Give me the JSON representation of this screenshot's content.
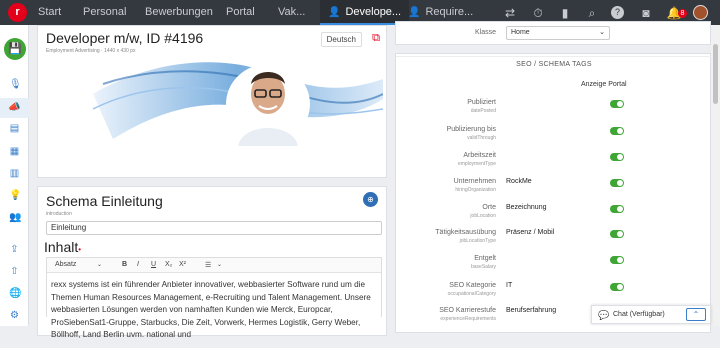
{
  "topnav": {
    "tabs": [
      "Start",
      "Personal",
      "Bewerbungen",
      "Portal",
      "Vak...",
      "Develope...",
      "Require..."
    ],
    "badge_count": "8"
  },
  "job": {
    "title": "Developer m/w, ID #4196",
    "lang_button": "Deutsch",
    "image_caption": "Employment Advertising · 1440 x 430 px"
  },
  "schema": {
    "heading": "Schema Einleitung",
    "field_key": "introduction",
    "value": "Einleitung",
    "content_heading": "Inhalt",
    "toolbar": {
      "format": "Absatz",
      "bold": "B",
      "italic": "I",
      "underline": "U",
      "subscript": "X₂",
      "superscript": "X²",
      "list": "☰"
    },
    "body_text": "rexx systems ist ein führender Anbieter innovativer, webbasierter Software rund um die Themen Human Resources Management, e-Recruiting und Talent Management. Unsere webbasierten Lösungen werden von namhaften Kunden wie Merck, Europcar, ProSiebenSat1-Gruppe, Starbucks, Die Zeit, Vorwerk, Hermes Logistik, Gerry Weber, Böllhoff, Land Berlin uvm. national und"
  },
  "right": {
    "klasse_label": "Klasse",
    "klasse_value": "Home",
    "section_title": "SEO / SCHEMA TAGS",
    "column_header": "Anzeige Portal",
    "rows": [
      {
        "label": "Publiziert",
        "field": "datePosted",
        "value": ""
      },
      {
        "label": "Publizierung bis",
        "field": "validThrough",
        "value": ""
      },
      {
        "label": "Arbeitszeit",
        "field": "employmentType",
        "value": ""
      },
      {
        "label": "Unternehmen",
        "field": "hiringOrganization",
        "value": "RockMe"
      },
      {
        "label": "Orte",
        "field": "jobLocation",
        "value": "Bezeichnung"
      },
      {
        "label": "Tätigkeitsausübung",
        "field": "jobLocationType",
        "value": "Präsenz / Mobil"
      },
      {
        "label": "Entgelt",
        "field": "baseSalary",
        "value": ""
      },
      {
        "label": "SEO Kategorie",
        "field": "occupationalCategory",
        "value": "IT"
      },
      {
        "label": "SEO Karrierestufe",
        "field": "experienceRequirements",
        "value": "Berufserfahrung"
      }
    ]
  },
  "chat": {
    "label": "Chat (Verfügbar)"
  },
  "colors": {
    "topbar": "#34393f",
    "accent_green": "#3fa535",
    "brand_red": "#e2001a",
    "link_blue": "#3a7fc9"
  }
}
